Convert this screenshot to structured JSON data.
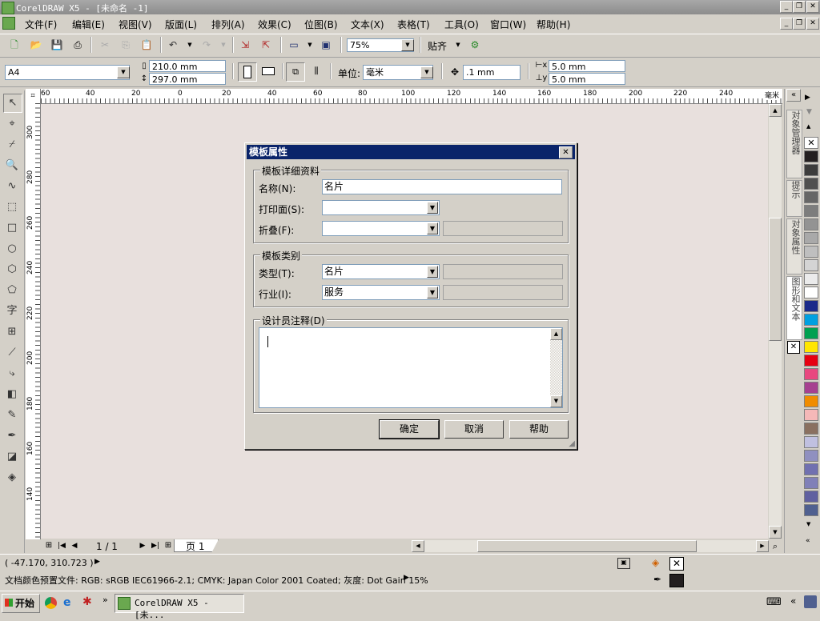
{
  "window": {
    "title": "CorelDRAW X5 - [未命名 -1]"
  },
  "menu": [
    "文件(F)",
    "编辑(E)",
    "视图(V)",
    "版面(L)",
    "排列(A)",
    "效果(C)",
    "位图(B)",
    "文本(X)",
    "表格(T)",
    "工具(O)",
    "窗口(W)",
    "帮助(H)"
  ],
  "standard_toolbar": {
    "zoom": "75%",
    "snap_label": "贴齐"
  },
  "property_bar": {
    "page_size": "A4",
    "width": "210.0 mm",
    "height": "297.0 mm",
    "units_label": "单位:",
    "units_value": "毫米",
    "nudge": ".1 mm",
    "dup_x": "5.0 mm",
    "dup_y": "5.0 mm"
  },
  "ruler": {
    "h_labels": [
      "60",
      "40",
      "20",
      "0",
      "20",
      "40",
      "60",
      "80",
      "100",
      "120",
      "140",
      "160",
      "180",
      "200",
      "220",
      "240",
      "毫米"
    ],
    "v_labels": [
      "300",
      "280",
      "260",
      "240",
      "220",
      "200",
      "180",
      "160",
      "140"
    ]
  },
  "page_nav": {
    "count": "1 / 1",
    "tab": "页 1"
  },
  "docker_tabs": [
    "对象管理器",
    "提示",
    "对象属性",
    "图形和文本"
  ],
  "palette": [
    "#231f20",
    "#3c3c3c",
    "#505050",
    "#666666",
    "#7d7d7d",
    "#939393",
    "#a9a9a9",
    "#bfbfbf",
    "#d4d4d4",
    "#ebebeb",
    "#ffffff",
    "#1b2a8a",
    "#00a0e0",
    "#00a050",
    "#ffe600",
    "#e60012",
    "#e8477f",
    "#a64090",
    "#f08c00",
    "#f5b8b8",
    "#8a7060",
    "#c0c0e0",
    "#9090c0",
    "#7070b0",
    "#8080b8",
    "#6060a0",
    "#506090"
  ],
  "status": {
    "coords": "( -47.170, 310.723 )",
    "color_profile": "文档颜色预置文件: RGB: sRGB IEC61966-2.1; CMYK: Japan Color 2001 Coated; 灰度: Dot Gain 15%"
  },
  "taskbar": {
    "start": "开始",
    "task": "CorelDRAW X5 - [未..."
  },
  "dialog": {
    "title": "模板属性",
    "group_details": "模板详细资料",
    "name_label": "名称(N):",
    "name_value": "名片",
    "print_side_label": "打印面(S):",
    "print_side_value": "",
    "fold_label": "折叠(F):",
    "fold_value": "",
    "group_category": "模板类别",
    "type_label": "类型(T):",
    "type_value": "名片",
    "industry_label": "行业(I):",
    "industry_value": "服务",
    "notes_label": "设计员注释(D)",
    "notes_value": "",
    "ok": "确定",
    "cancel": "取消",
    "help": "帮助"
  }
}
